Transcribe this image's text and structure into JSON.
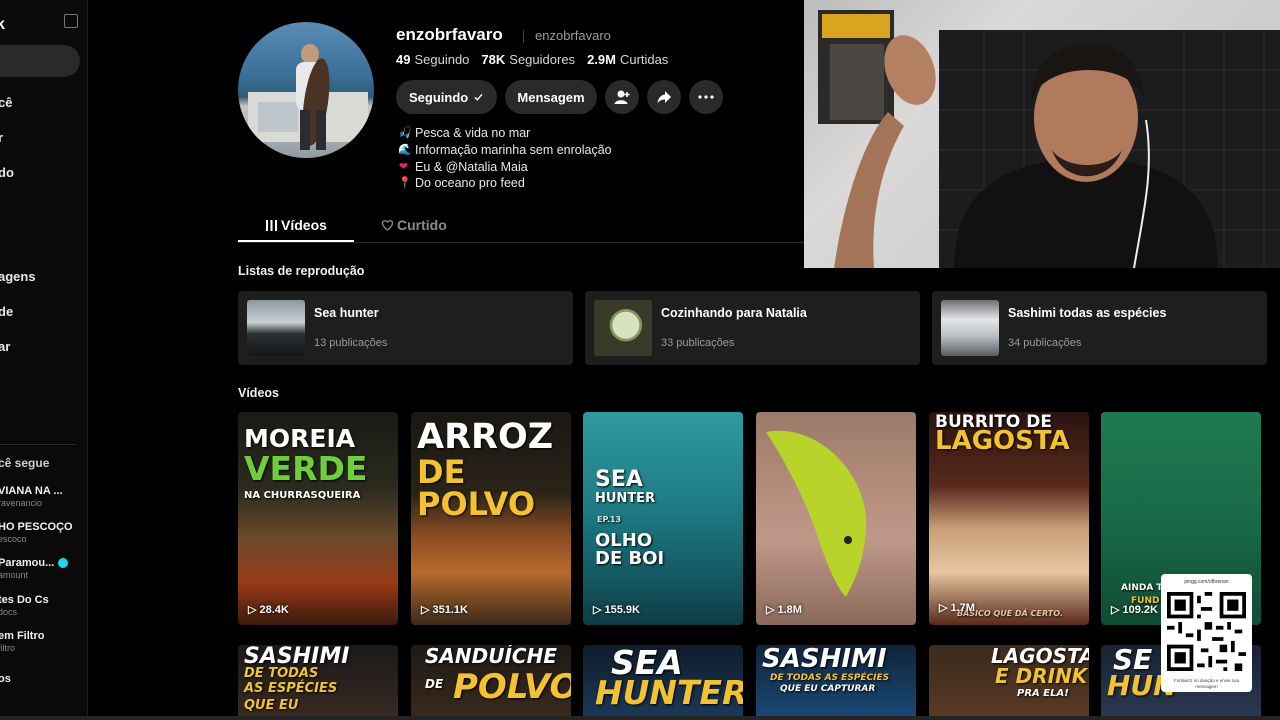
{
  "sidebar": {
    "logo": "k",
    "nav": [
      "cê",
      "r",
      "do",
      "agens",
      "de",
      "ar"
    ],
    "following_title": "cê segue",
    "accounts": [
      {
        "name": "VIANA NA ...",
        "handle": "ravenancio"
      },
      {
        "name": "HO PESCOÇO",
        "handle": "escoco"
      },
      {
        "name": "Paramou...",
        "handle": "amount",
        "verified": true
      },
      {
        "name": "tes Do Cs",
        "handle": "docs"
      },
      {
        "name": "em Filtro",
        "handle": "filtro"
      },
      {
        "name": "os",
        "handle": ""
      }
    ]
  },
  "profile": {
    "username": "enzobrfavaro",
    "handle": "enzobrfavaro",
    "stats": [
      {
        "value": "49",
        "label": "Seguindo"
      },
      {
        "value": "78K",
        "label": "Seguidores"
      },
      {
        "value": "2.9M",
        "label": "Curtidas"
      }
    ],
    "following_button": "Seguindo",
    "message_button": "Mensagem",
    "bio": [
      {
        "emoji": "🎣",
        "text": "Pesca & vida no mar"
      },
      {
        "emoji": "🌊",
        "text": "Informação marinha sem enrolação"
      },
      {
        "emoji": "❤",
        "text": "Eu & @Natalia Maia"
      },
      {
        "emoji": "📍",
        "text": "Do oceano pro feed"
      }
    ]
  },
  "tabs": {
    "videos": "Vídeos",
    "liked": "Curtido"
  },
  "playlists_title": "Listas de reprodução",
  "playlists": [
    {
      "title": "Sea hunter",
      "count": "13 publicações"
    },
    {
      "title": "Cozinhando para Natalia",
      "count": "33 publicações"
    },
    {
      "title": "Sashimi todas as espécies",
      "count": "34 publicações"
    }
  ],
  "videos_title": "Vídeos",
  "videos": [
    {
      "line1": "MOREIA",
      "line2": "VERDE",
      "line3": "NA CHURRASQUEIRA",
      "views": "28.4K"
    },
    {
      "line1": "ARROZ",
      "line2": "DE POLVO",
      "line3": "",
      "views": "351.1K"
    },
    {
      "line1": "SEA",
      "line2": "HUNTER",
      "line3": "EP.13",
      "line4": "OLHO",
      "line5": "DE BOI",
      "views": "155.9K"
    },
    {
      "line1": "",
      "line2": "",
      "line3": "",
      "views": "1.8M"
    },
    {
      "line1": "BURRITO DE",
      "line2": "LAGOSTA",
      "line3": "BÁSICO QUE DÁ CERTO.",
      "views": "1.7M"
    },
    {
      "line1": "AINDA TÁ",
      "line2": "FUND",
      "line3": "",
      "views": "109.2K"
    }
  ],
  "videos_row2": [
    {
      "line1": "SASHIMI",
      "line2": "DE TODAS",
      "line3": "AS ESPÉCIES",
      "line4": "QUE EU"
    },
    {
      "line1": "SANDUÍCHE",
      "line2": "DE",
      "line3": "POLVO"
    },
    {
      "line1": "SEA",
      "line2": "HUNTER"
    },
    {
      "line1": "SASHIMI",
      "line2": "DE TODAS AS ESPÉCIES",
      "line3": "QUE EU CAPTURAR"
    },
    {
      "line1": "LAGOSTA",
      "line2": "E DRINK",
      "line3": "PRA ELA!"
    },
    {
      "line1": "SE",
      "line2": "HUN"
    }
  ],
  "overlay": {
    "qr_url": "pingg.com/ofbrenan",
    "qr_note": "Fortalezz no doação e envie sua mensagem"
  },
  "colors": {
    "background": "#000000",
    "card": "#1e1e1e",
    "button": "#2a2a2a",
    "accent_green": "#6fcf3a",
    "accent_yellow": "#f2c230"
  }
}
